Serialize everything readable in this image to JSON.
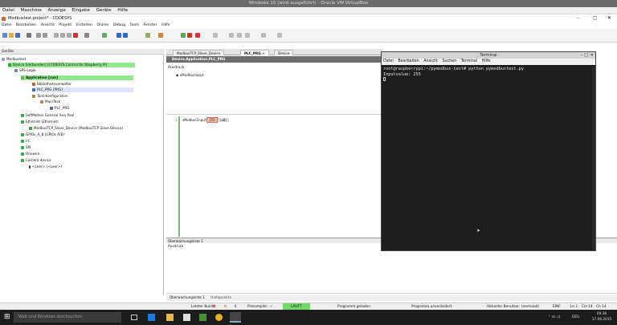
{
  "vbox": {
    "title": "Windows 10 (wird ausgeführt) - Oracle VM VirtualBox",
    "menu": [
      "Datei",
      "Maschine",
      "Anzeige",
      "Eingabe",
      "Geräte",
      "Hilfe"
    ]
  },
  "codesys": {
    "title": "Modbustest.project* - CODESYS",
    "menu": [
      "Datei",
      "Bearbeiten",
      "Ansicht",
      "Projekt",
      "Erstellen",
      "Online",
      "Debug",
      "Tools",
      "Fenster",
      "Hilfe"
    ]
  },
  "devices": {
    "header": "Geräte",
    "tree": [
      "Modbustest",
      "Device [verbunden] (CODESYS Control for Raspberry Pi)",
      "SPS-Logik",
      "Application [run]",
      "Bibliotheksverwalter",
      "PLC_PRG (PRG)",
      "Task-Konfiguration",
      "MainTask",
      "PLC_PRG",
      "SoftMotion General Axis Pool",
      "Ethernet (Ethernet)",
      "ModbusTCP_Slave_Device (ModbusTCP Slave Device)",
      "GPIOs_A_B (GPIOs A/B)",
      "I²C",
      "SPI",
      "Onewire",
      "Camera device",
      "<Leer> (<Leer>)"
    ]
  },
  "editor": {
    "tabs": [
      "ModbusTCP_Slave_Device",
      "PLC_PRG",
      "Device"
    ],
    "path": "Device.Application.PLC_PRG",
    "decl_header": "Ausdruck",
    "decl_var": "xModbusInput",
    "code_prefix": "xModbusInput",
    "code_value": "255",
    "code_suffix": ":=0;"
  },
  "watch": {
    "title": "Überwachungsliste 1",
    "col_expr": "Ausdruck",
    "tabs": [
      "Überwachungsliste 1",
      "Haltepunkte"
    ]
  },
  "terminal": {
    "title": "Terminal",
    "menu": [
      "Datei",
      "Bearbeiten",
      "Ansicht",
      "Suchen",
      "Terminal",
      "Hilfe"
    ],
    "line1": "root@raspberrypi:~/pymodbus-test# python pymodbustest.py",
    "line2": "Inputvalue: 255"
  },
  "status": {
    "last_build": "Letzter Build:",
    "errors": "0",
    "warnings": "0",
    "info": "1",
    "precompile": "Precompile:",
    "run": "LÄUFT",
    "program_loaded": "Programm geladen",
    "program_unchanged": "Programm unverändert",
    "user": "Aktueller Benutzer: (niemand)",
    "insert": "EINF",
    "pos_line": "Ln 1",
    "pos_col": "Col 14",
    "pos_ch": "Ch 14"
  },
  "taskbar": {
    "search": "Web und Windows durchsuchen",
    "time": "09:36",
    "date": "17.08.2015",
    "lang": "DEU"
  }
}
